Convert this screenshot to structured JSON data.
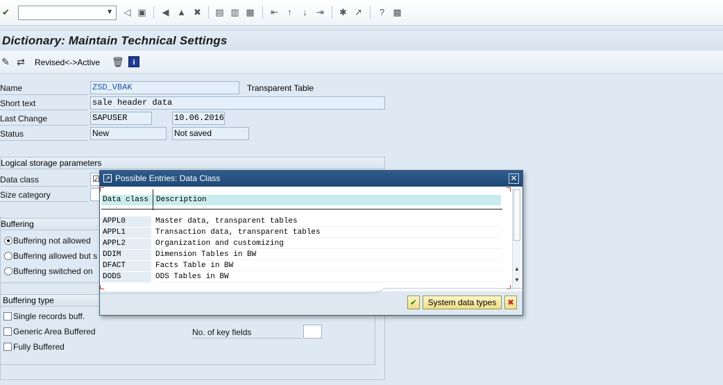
{
  "toolbar": {
    "command_field_value": "",
    "icons": [
      "check-icon",
      "back-icon",
      "save-icon",
      "back-nav-icon",
      "exit-icon",
      "cancel-icon",
      "print-icon",
      "find-icon",
      "find-next-icon",
      "first-page-icon",
      "prev-page-icon",
      "next-page-icon",
      "last-page-icon",
      "new-session-icon",
      "shortcut-icon",
      "help-icon",
      "layout-icon"
    ]
  },
  "title": "Dictionary: Maintain Technical Settings",
  "app_toolbar": {
    "revised_active": "Revised<->Active"
  },
  "form": {
    "name_label": "Name",
    "name_value": "ZSD_VBAK",
    "name_type": "Transparent Table",
    "short_text_label": "Short text",
    "short_text_value": "sale header data",
    "last_change_label": "Last Change",
    "last_change_user": "SAPUSER",
    "last_change_date": "10.06.2016",
    "status_label": "Status",
    "status_value": "New",
    "status_saved": "Not saved"
  },
  "logical_storage": {
    "header": "Logical storage parameters",
    "data_class_label": "Data class",
    "size_category_label": "Size category"
  },
  "buffering": {
    "header": "Buffering",
    "options": [
      "Buffering not allowed",
      "Buffering allowed but s",
      "Buffering switched on"
    ],
    "selected": 0
  },
  "buffering_type": {
    "header": "Buffering type",
    "options": [
      "Single records buff.",
      "Generic Area Buffered",
      "Fully Buffered"
    ],
    "key_fields_label": "No. of key fields",
    "key_fields_value": ""
  },
  "dialog": {
    "title": "Possible Entries: Data Class",
    "col_key": "Data class",
    "col_desc": "Description",
    "rows": [
      {
        "key": "APPL0",
        "desc": "Master data, transparent tables"
      },
      {
        "key": "APPL1",
        "desc": "Transaction data, transparent tables"
      },
      {
        "key": "APPL2",
        "desc": "Organization and customizing"
      },
      {
        "key": "DDIM",
        "desc": "Dimension Tables in BW"
      },
      {
        "key": "DFACT",
        "desc": "Facts Table in BW"
      },
      {
        "key": "DODS",
        "desc": "ODS Tables in BW"
      }
    ],
    "system_data_types_button": "System data types"
  },
  "colors": {
    "accent": "#1f4876",
    "field_bg": "#e5eff9",
    "button_bg": "#f2dd86",
    "cancel_red": "#c0302a",
    "confirm_green": "#3d8a22"
  }
}
